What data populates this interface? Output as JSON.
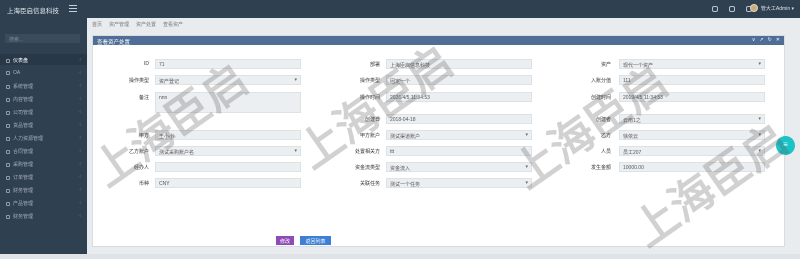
{
  "topbar": {
    "brand": "上海臣启信息科技",
    "user": "管大工Admin ▾"
  },
  "search_placeholder": "搜索...",
  "sidebar": [
    {
      "label": "仪表盘"
    },
    {
      "label": "OA"
    },
    {
      "label": "系统管理"
    },
    {
      "label": "内容管理"
    },
    {
      "label": "公司管理"
    },
    {
      "label": "货品管理"
    },
    {
      "label": "人力资源管理"
    },
    {
      "label": "合同管理"
    },
    {
      "label": "采购管理"
    },
    {
      "label": "订单管理"
    },
    {
      "label": "财务管理"
    },
    {
      "label": "产品管理"
    },
    {
      "label": "财务管理"
    }
  ],
  "breadcrumb": [
    "首页",
    "资产管理",
    "资产处置",
    "查看资产"
  ],
  "panel": {
    "title": "查看资产处置",
    "tools": [
      "∨",
      "↗",
      "↻",
      "✕"
    ]
  },
  "form": {
    "r1": [
      {
        "label": "ID",
        "value": "71"
      },
      {
        "label": "部署",
        "value": "上海臣启信息科技"
      },
      {
        "label": "资产",
        "value": "现代一个资产"
      }
    ],
    "r2": [
      {
        "label": "操作类型",
        "value": "资产登记"
      },
      {
        "label": "操作类型",
        "value": "固定一个"
      },
      {
        "label": "入账分值",
        "value": "111"
      }
    ],
    "r3": [
      {
        "label": "备注",
        "value": "nnn"
      },
      {
        "label": "操作时间",
        "value": "2026/4/5 11:34:53"
      },
      {
        "label": "创建时间",
        "value": "2019/4/5 11:34:53"
      }
    ],
    "r4": [
      {
        "label": "创建日",
        "value": "2018-04-18"
      },
      {
        "label": "创建者",
        "value": "云南1之"
      }
    ],
    "r5": [
      {
        "label": "甲方",
        "value": "王小小"
      },
      {
        "label": "甲方账户",
        "value": "测试渠道账户"
      },
      {
        "label": "乙方",
        "value": "徐依云"
      }
    ],
    "r6": [
      {
        "label": "乙方账户",
        "value": "测试采购账户名"
      },
      {
        "label": "处置相关方",
        "value": "ttt"
      },
      {
        "label": "人员",
        "value": "员工207"
      }
    ],
    "r7": [
      {
        "label": "经办人",
        "value": ""
      },
      {
        "label": "资金流类型",
        "value": "资金流入"
      },
      {
        "label": "发生金额",
        "value": "10000.00"
      }
    ],
    "r8": [
      {
        "label": "币种",
        "value": "CNY"
      },
      {
        "label": "关联任务",
        "value": "测试一个任务"
      }
    ]
  },
  "buttons": {
    "edit": "修改",
    "back": "返回列表"
  },
  "watermark": "上海臣启"
}
